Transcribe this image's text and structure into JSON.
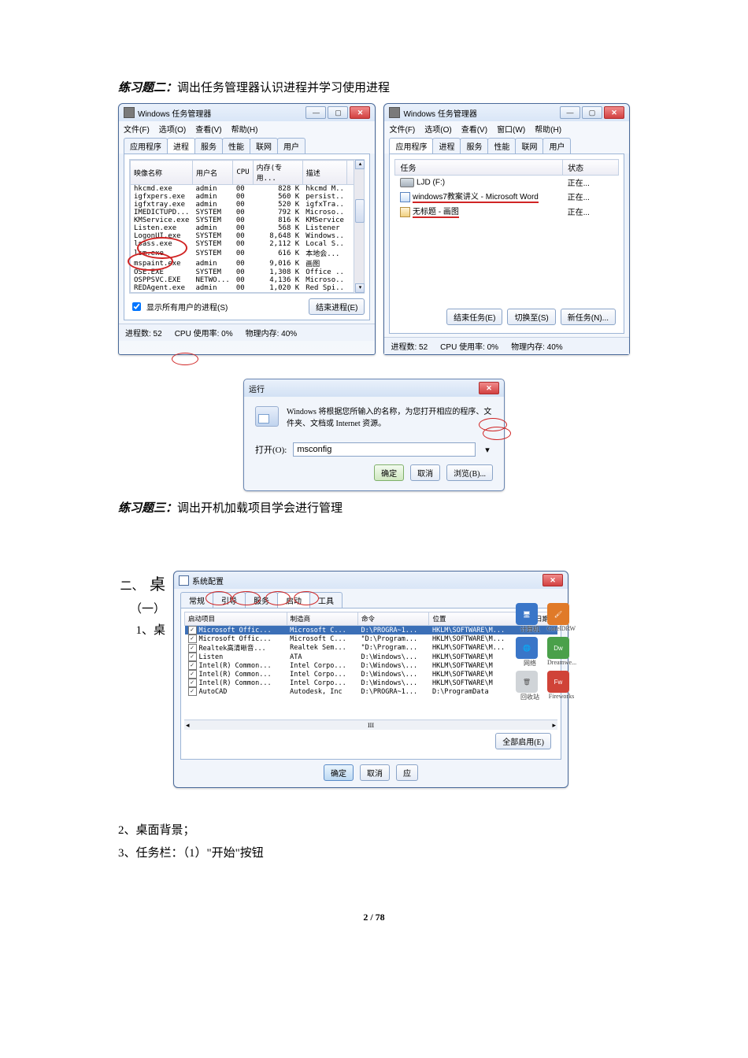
{
  "exercise2": {
    "title_prefix": "练习题二：",
    "title_rest": "调出任务管理器认识进程并学习使用进程"
  },
  "tm_left": {
    "title": "Windows 任务管理器",
    "menu": [
      "文件(F)",
      "选项(O)",
      "查看(V)",
      "帮助(H)"
    ],
    "tabs": [
      "应用程序",
      "进程",
      "服务",
      "性能",
      "联网",
      "用户"
    ],
    "active_tab": 1,
    "columns": [
      "映像名称",
      "用户名",
      "CPU",
      "内存(专用...",
      "描述"
    ],
    "rows": [
      [
        "hkcmd.exe",
        "admin",
        "00",
        "828 K",
        "hkcmd M.."
      ],
      [
        "igfxpers.exe",
        "admin",
        "00",
        "560 K",
        "persist.."
      ],
      [
        "igfxtray.exe",
        "admin",
        "00",
        "520 K",
        "igfxTra.."
      ],
      [
        "IMEDICTUPD...",
        "SYSTEM",
        "00",
        "792 K",
        "Microso.."
      ],
      [
        "KMService.exe",
        "SYSTEM",
        "00",
        "816 K",
        "KMService"
      ],
      [
        "Listen.exe",
        "admin",
        "00",
        "568 K",
        "Listener"
      ],
      [
        "LogonUI.exe",
        "SYSTEM",
        "00",
        "8,648 K",
        "Windows.."
      ],
      [
        "lsass.exe",
        "SYSTEM",
        "00",
        "2,112 K",
        "Local S.."
      ],
      [
        "lsm.exe",
        "SYSTEM",
        "00",
        "616 K",
        "本地会..."
      ],
      [
        "mspaint.exe",
        "admin",
        "00",
        "9,016 K",
        "画图"
      ],
      [
        "OSE.EXE",
        "SYSTEM",
        "00",
        "1,308 K",
        "Office .."
      ],
      [
        "OSPPSVC.EXE",
        "NETWO...",
        "00",
        "4,136 K",
        "Microso.."
      ],
      [
        "REDAgent.exe",
        "admin",
        "00",
        "1,020 K",
        "Red Spi.."
      ]
    ],
    "show_all": "显示所有用户的进程(S)",
    "end_proc": "结束进程(E)",
    "status": [
      "进程数: 52",
      "CPU 使用率: 0%",
      "物理内存: 40%"
    ]
  },
  "tm_right": {
    "title": "Windows 任务管理器",
    "menu": [
      "文件(F)",
      "选项(O)",
      "查看(V)",
      "窗口(W)",
      "帮助(H)"
    ],
    "tabs": [
      "应用程序",
      "进程",
      "服务",
      "性能",
      "联网",
      "用户"
    ],
    "active_tab": 0,
    "columns": [
      "任务",
      "状态"
    ],
    "rows": [
      {
        "icon": "drive",
        "text": "LJD (F:)",
        "status": "正在..."
      },
      {
        "icon": "doc",
        "text": "windows7教案讲义 - Microsoft Word",
        "status": "正在..."
      },
      {
        "icon": "paint",
        "text": "无标题 - 画图",
        "status": "正在..."
      }
    ],
    "buttons": [
      "结束任务(E)",
      "切换至(S)",
      "新任务(N)..."
    ],
    "status": [
      "进程数: 52",
      "CPU 使用率: 0%",
      "物理内存: 40%"
    ]
  },
  "run": {
    "title": "运行",
    "desc": "Windows 将根据您所输入的名称，为您打开相应的程序、文件夹、文档或 Internet 资源。",
    "open_label": "打开(O):",
    "value": "msconfig",
    "ok": "确定",
    "cancel": "取消",
    "browse": "浏览(B)..."
  },
  "exercise3": {
    "title_prefix": "练习题三：",
    "title_rest": "调出开机加载项目学会进行管理"
  },
  "msconfig": {
    "title": "系统配置",
    "tabs": [
      "常规",
      "引导",
      "服务",
      "启动",
      "工具"
    ],
    "active_tab": 3,
    "columns": [
      "启动项目",
      "制造商",
      "命令",
      "位置",
      "禁用日期"
    ],
    "rows": [
      {
        "sel": true,
        "chk": true,
        "name": "Microsoft Offic...",
        "mfr": "Microsoft C...",
        "cmd": "D:\\PROGRA~1...",
        "loc": "HKLM\\SOFTWARE\\M..."
      },
      {
        "sel": false,
        "chk": true,
        "name": "Microsoft Offic...",
        "mfr": "Microsoft C...",
        "cmd": "\"D:\\Program...",
        "loc": "HKLM\\SOFTWARE\\M..."
      },
      {
        "sel": false,
        "chk": true,
        "name": "Realtek高清晰音...",
        "mfr": "Realtek Sem...",
        "cmd": "\"D:\\Program...",
        "loc": "HKLM\\SOFTWARE\\M..."
      },
      {
        "sel": false,
        "chk": true,
        "name": "Listen",
        "mfr": "ATA",
        "cmd": "D:\\Windows\\...",
        "loc": "HKLM\\SOFTWARE\\M"
      },
      {
        "sel": false,
        "chk": true,
        "name": "Intel(R) Common...",
        "mfr": "Intel Corpo...",
        "cmd": "D:\\Windows\\...",
        "loc": "HKLM\\SOFTWARE\\M"
      },
      {
        "sel": false,
        "chk": true,
        "name": "Intel(R) Common...",
        "mfr": "Intel Corpo...",
        "cmd": "D:\\Windows\\...",
        "loc": "HKLM\\SOFTWARE\\M"
      },
      {
        "sel": false,
        "chk": true,
        "name": "Intel(R) Common...",
        "mfr": "Intel Corpo...",
        "cmd": "D:\\Windows\\...",
        "loc": "HKLM\\SOFTWARE\\M"
      },
      {
        "sel": false,
        "chk": true,
        "name": "AutoCAD",
        "mfr": "Autodesk, Inc",
        "cmd": "D:\\PROGRA~1...",
        "loc": "D:\\ProgramData"
      }
    ],
    "enable_all": "全部启用(E)",
    "ok": "确定",
    "cancel": "取消",
    "apply": "应"
  },
  "desk": [
    {
      "label": "计算机",
      "color": "#3a76c8"
    },
    {
      "label": "CorelDRW",
      "color": "#e07a28"
    },
    {
      "label": "网络",
      "color": "#3a76c8"
    },
    {
      "label": "Dreamwe...",
      "color": "#4aa04a"
    },
    {
      "label": "回收站",
      "color": "#d0d4d8"
    },
    {
      "label": "Fireworks",
      "color": "#d04338"
    }
  ],
  "side": {
    "l1": "二、",
    "l2": "桌",
    "l3": "（一）",
    "l4": "1、",
    "l5": "桌"
  },
  "body": {
    "line2": "2、桌面背景；",
    "line3": "3、任务栏：（1）\"开始\"按钮"
  },
  "footer": "2 / 78"
}
